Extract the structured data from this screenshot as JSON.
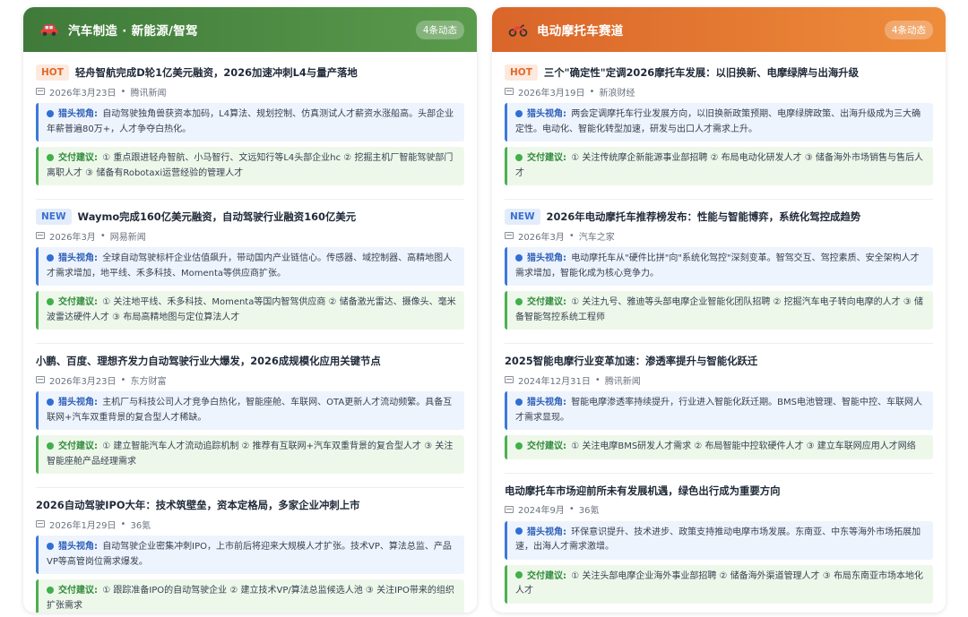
{
  "panels": [
    {
      "title": "汽车制造 · 新能源/智驾",
      "count": "4条动态",
      "icon": "car-icon",
      "items": [
        {
          "tag": "HOT",
          "title": "轻舟智航完成D轮1亿美元融资，2026加速冲刺L4与量产落地",
          "date": "2026年3月23日",
          "source": "腾讯新闻",
          "view_label": "猎头视角:",
          "view": "自动驾驶独角兽获资本加码，L4算法、规划控制、仿真测试人才薪资水涨船高。头部企业年薪普遍80万+，人才争夺白热化。",
          "advice_label": "交付建议:",
          "advice": "① 重点跟进轻舟智航、小马智行、文远知行等L4头部企业hc ② 挖掘主机厂智能驾驶部门离职人才 ③ 储备有Robotaxi运营经验的管理人才"
        },
        {
          "tag": "NEW",
          "title": "Waymo完成160亿美元融资，自动驾驶行业融资160亿美元",
          "date": "2026年3月",
          "source": "网易新闻",
          "view_label": "猎头视角:",
          "view": "全球自动驾驶标杆企业估值飙升，带动国内产业链信心。传感器、域控制器、高精地图人才需求增加，地平线、禾多科技、Momenta等供应商扩张。",
          "advice_label": "交付建议:",
          "advice": "① 关注地平线、禾多科技、Momenta等国内智驾供应商 ② 储备激光雷达、摄像头、毫米波雷达硬件人才 ③ 布局高精地图与定位算法人才"
        },
        {
          "tag": "",
          "title": "小鹏、百度、理想齐发力自动驾驶行业大爆发，2026成规模化应用关键节点",
          "date": "2026年3月23日",
          "source": "东方财富",
          "view_label": "猎头视角:",
          "view": "主机厂与科技公司人才竞争白热化，智能座舱、车联网、OTA更新人才流动频繁。具备互联网+汽车双重背景的复合型人才稀缺。",
          "advice_label": "交付建议:",
          "advice": "① 建立智能汽车人才流动追踪机制 ② 推荐有互联网+汽车双重背景的复合型人才 ③ 关注智能座舱产品经理需求"
        },
        {
          "tag": "",
          "title": "2026自动驾驶IPO大年：技术筑壁垒，资本定格局，多家企业冲刺上市",
          "date": "2026年1月29日",
          "source": "36氪",
          "view_label": "猎头视角:",
          "view": "自动驾驶企业密集冲刺IPO，上市前后将迎来大规模人才扩张。技术VP、算法总监、产品VP等高管岗位需求爆发。",
          "advice_label": "交付建议:",
          "advice": "① 跟踪准备IPO的自动驾驶企业 ② 建立技术VP/算法总监候选人池 ③ 关注IPO带来的组织扩张需求"
        }
      ]
    },
    {
      "title": "电动摩托车赛道",
      "count": "4条动态",
      "icon": "motorcycle-icon",
      "items": [
        {
          "tag": "HOT",
          "title": "三个\"确定性\"定调2026摩托车发展：以旧换新、电摩绿牌与出海升级",
          "date": "2026年3月19日",
          "source": "新浪财经",
          "view_label": "猎头视角:",
          "view": "两会定调摩托车行业发展方向，以旧换新政策预期、电摩绿牌政策、出海升级成为三大确定性。电动化、智能化转型加速，研发与出口人才需求上升。",
          "advice_label": "交付建议:",
          "advice": "① 关注传统摩企新能源事业部招聘 ② 布局电动化研发人才 ③ 储备海外市场销售与售后人才"
        },
        {
          "tag": "NEW",
          "title": "2026年电动摩托车推荐榜发布：性能与智能博弈，系统化驾控成趋势",
          "date": "2026年3月",
          "source": "汽车之家",
          "view_label": "猎头视角:",
          "view": "电动摩托车从\"硬件比拼\"向\"系统化驾控\"深刻变革。智驾交互、驾控素质、安全架构人才需求增加，智能化成为核心竞争力。",
          "advice_label": "交付建议:",
          "advice": "① 关注九号、雅迪等头部电摩企业智能化团队招聘 ② 挖掘汽车电子转向电摩的人才 ③ 储备智能驾控系统工程师"
        },
        {
          "tag": "",
          "title": "2025智能电摩行业变革加速：渗透率提升与智能化跃迁",
          "date": "2024年12月31日",
          "source": "腾讯新闻",
          "view_label": "猎头视角:",
          "view": "智能电摩渗透率持续提升，行业进入智能化跃迁期。BMS电池管理、智能中控、车联网人才需求显现。",
          "advice_label": "交付建议:",
          "advice": "① 关注电摩BMS研发人才需求 ② 布局智能中控软硬件人才 ③ 建立车联网应用人才网络"
        },
        {
          "tag": "",
          "title": "电动摩托车市场迎前所未有发展机遇，绿色出行成为重要方向",
          "date": "2024年9月",
          "source": "36氪",
          "view_label": "猎头视角:",
          "view": "环保意识提升、技术进步、政策支持推动电摩市场发展。东南亚、中东等海外市场拓展加速，出海人才需求激增。",
          "advice_label": "交付建议:",
          "advice": "① 关注头部电摩企业海外事业部招聘 ② 储备海外渠道管理人才 ③ 布局东南亚市场本地化人才"
        }
      ]
    }
  ]
}
